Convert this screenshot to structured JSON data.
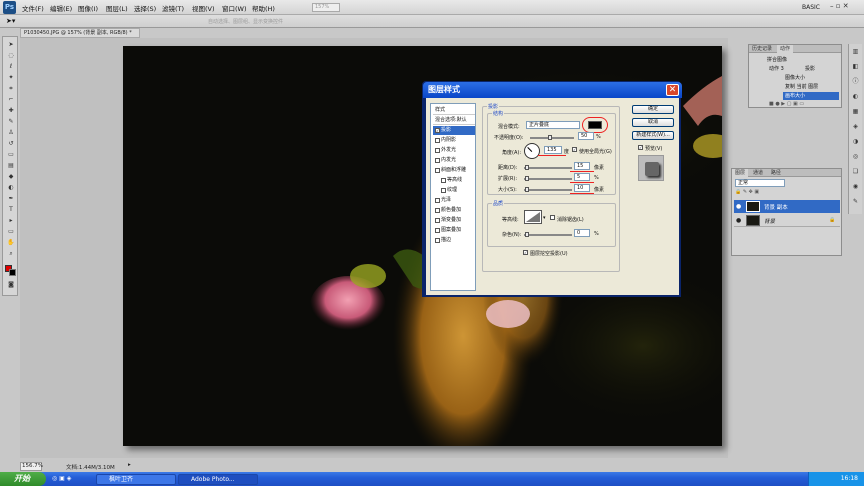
{
  "app": {
    "logo": "Ps",
    "workspace": "BASIC",
    "zoom_select": "157%"
  },
  "menus": [
    "文件(F)",
    "编辑(E)",
    "图像(I)",
    "图层(L)",
    "选择(S)",
    "滤镜(T)",
    "视图(V)",
    "窗口(W)",
    "帮助(H)"
  ],
  "optbar": {
    "hint": "自动选择、图层组、显示变换控件"
  },
  "document": {
    "tab": "P1030450.JPG @ 157% (背景 副本, RGB/8) *"
  },
  "status": {
    "zoom": "156.7%",
    "doc_size": "文档:1.44M/3.10M"
  },
  "dialog": {
    "title": "图层样式",
    "styles": [
      {
        "label": "样式",
        "check": false,
        "header": true
      },
      {
        "label": "混合选项:默认",
        "check": false,
        "header": true
      },
      {
        "label": "投影",
        "check": true,
        "selected": true
      },
      {
        "label": "内阴影",
        "check": false
      },
      {
        "label": "外发光",
        "check": false
      },
      {
        "label": "内发光",
        "check": false
      },
      {
        "label": "斜面和浮雕",
        "check": false
      },
      {
        "label": "等高线",
        "check": false,
        "indent": true
      },
      {
        "label": "纹理",
        "check": false,
        "indent": true
      },
      {
        "label": "光泽",
        "check": false
      },
      {
        "label": "颜色叠加",
        "check": false
      },
      {
        "label": "渐变叠加",
        "check": false
      },
      {
        "label": "图案叠加",
        "check": false
      },
      {
        "label": "描边",
        "check": false
      }
    ],
    "section_title": "投影",
    "structure_title": "结构",
    "blend_mode_label": "混合模式:",
    "blend_mode_value": "正片叠底",
    "shadow_color": "#000000",
    "opacity_label": "不透明度(O):",
    "opacity_value": "50",
    "percent": "%",
    "angle_label": "角度(A):",
    "angle_value": "135",
    "degree": "度",
    "global_light_label": "使用全局光(G)",
    "distance_label": "距离(D):",
    "distance_value": "15",
    "pixel": "像素",
    "spread_label": "扩展(R):",
    "spread_value": "5",
    "size_label": "大小(S):",
    "size_value": "10",
    "quality_title": "品质",
    "contour_label": "等高线:",
    "antialias_label": "消除锯齿(L)",
    "noise_label": "杂色(N):",
    "noise_value": "0",
    "knockout_label": "图层挖空投影(U)",
    "ok": "确定",
    "cancel": "取消",
    "new_style": "新建样式(W)...",
    "preview": "预览(V)"
  },
  "actions_panel": {
    "tabs": [
      "历史记录",
      "动作"
    ],
    "items": [
      "拼合图像",
      "动作 3",
      "投影",
      "图像大小",
      "复制 当前 图层",
      "画布大小"
    ]
  },
  "layers_panel": {
    "tabs": [
      "图层",
      "通道",
      "路径"
    ],
    "blend": "正常",
    "layers": [
      {
        "name": "背景 副本",
        "selected": true
      },
      {
        "name": "背景",
        "selected": false
      }
    ]
  },
  "taskbar": {
    "start": "开始",
    "tasks": [
      "枫叶卫齐",
      "Adobe Photo..."
    ],
    "time": "16:18"
  },
  "colors": {
    "accent": "#0a246a",
    "selection": "#316ac5",
    "foreground": "#e00000",
    "background": "#000000"
  }
}
